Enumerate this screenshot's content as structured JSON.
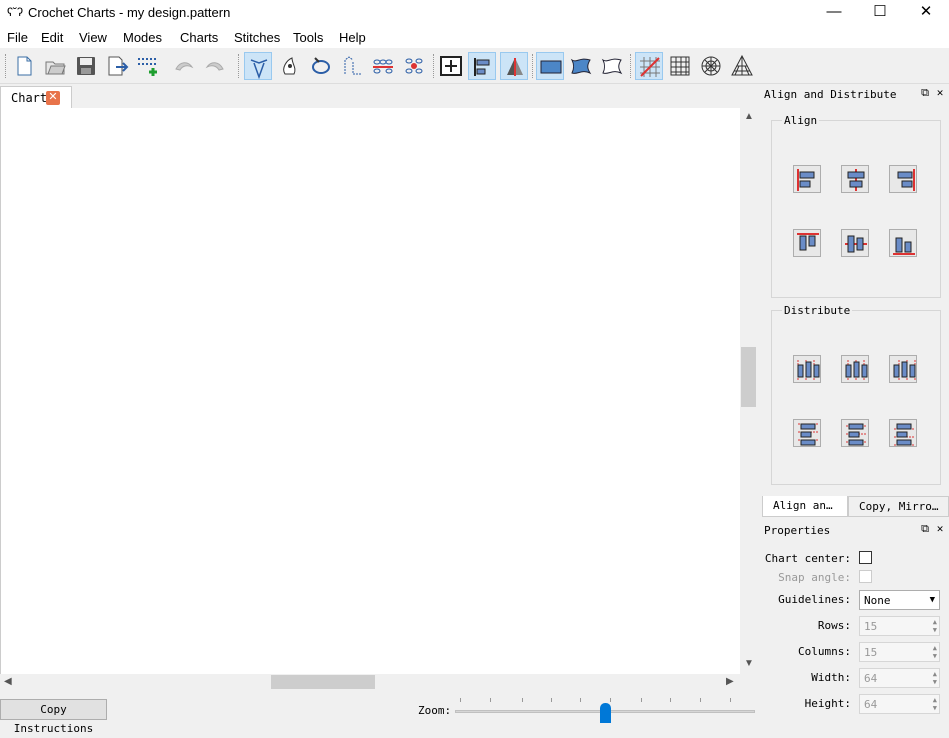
{
  "window": {
    "title": "Crochet Charts - my design.pattern",
    "app_icon": "crochet-icon",
    "minimize": "—",
    "maximize": "☐",
    "close": "✕"
  },
  "menu": [
    "File",
    "Edit",
    "View",
    "Modes",
    "Charts",
    "Stitches",
    "Tools",
    "Help"
  ],
  "toolbar": {
    "buttons": [
      "new-document-icon",
      "open-icon",
      "save-icon",
      "export-icon",
      "add-chart-icon",
      "undo-icon",
      "redo-icon",
      "stitch-edit-mode-icon",
      "color-mode-icon",
      "create-rows-icon",
      "indicator-mode-icon",
      "row-edit-icon",
      "grid-icon-2",
      "fit-view-icon",
      "align-icon",
      "mirror-icon",
      "rectangle-select-icon",
      "lasso-select-icon",
      "free-select-icon",
      "guidelines-none-icon",
      "grid-guidelines-icon",
      "round-guidelines-icon",
      "triangle-guidelines-icon"
    ]
  },
  "tabs": {
    "chart_label": "Chart",
    "close_glyph": "✕"
  },
  "status": {
    "copy_instructions": "Copy Instructions",
    "zoom_label": "Zoom:",
    "zoom_fraction": 0.5
  },
  "align_panel": {
    "title": "Align and Distribute",
    "align_group": "Align",
    "distribute_group": "Distribute",
    "align_buttons": [
      "align-left-icon",
      "align-h-center-icon",
      "align-right-icon",
      "align-top-icon",
      "align-v-center-icon",
      "align-bottom-icon"
    ],
    "distribute_buttons": [
      "distribute-left-icon",
      "distribute-h-center-icon",
      "distribute-right-icon",
      "distribute-top-icon",
      "distribute-v-center-icon",
      "distribute-bottom-icon"
    ]
  },
  "dock_tabs": [
    "Align an…",
    "Copy, Mirro…"
  ],
  "properties": {
    "title": "Properties",
    "chart_center_label": "Chart center:",
    "snap_angle_label": "Snap angle:",
    "guidelines_label": "Guidelines:",
    "guidelines_value": "None",
    "rows_label": "Rows:",
    "rows_value": "15",
    "columns_label": "Columns:",
    "columns_value": "15",
    "width_label": "Width:",
    "width_value": "64",
    "height_label": "Height:",
    "height_value": "64"
  },
  "colors": {
    "accent": "#0078d7",
    "active_button_bg": "#cce4f7",
    "tab_close": "#e8734a"
  }
}
